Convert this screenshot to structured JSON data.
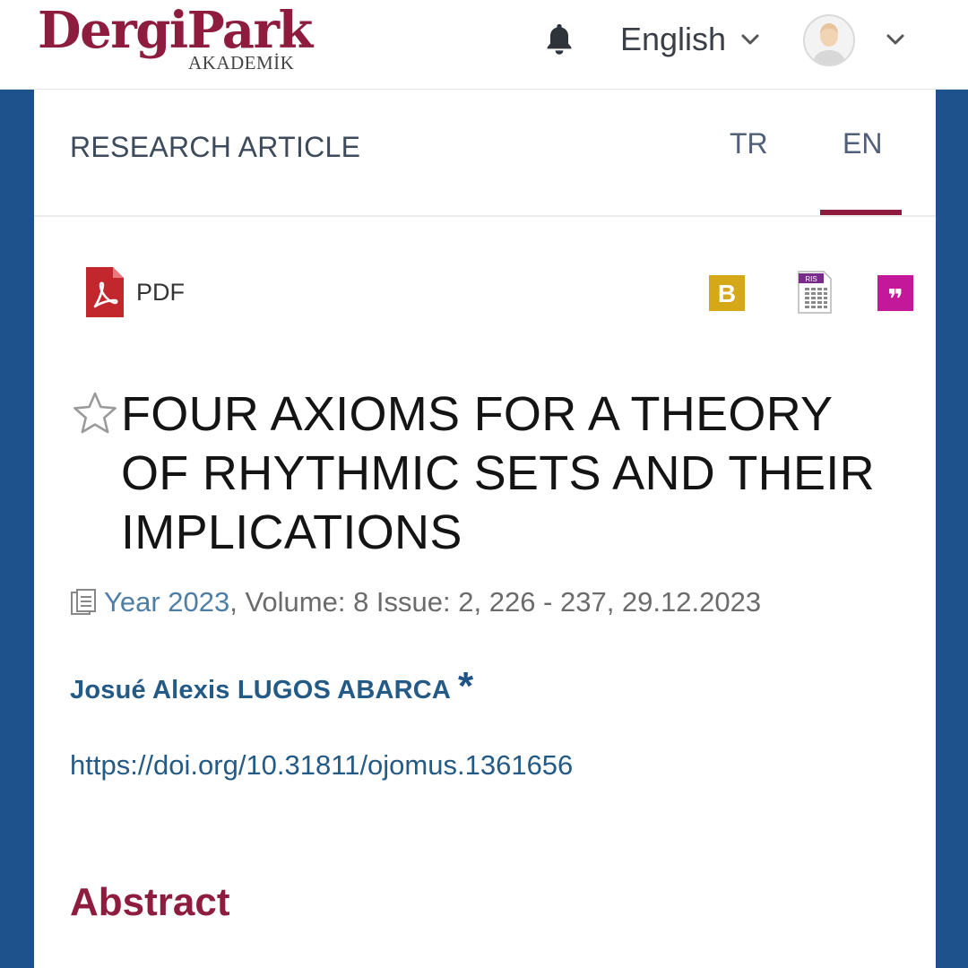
{
  "header": {
    "logo_main": "DergiPark",
    "logo_sub": "AKADEMİK",
    "language": "English"
  },
  "article": {
    "type": "RESEARCH ARTICLE",
    "tabs": [
      {
        "label": "TR",
        "active": false
      },
      {
        "label": "EN",
        "active": true
      }
    ],
    "pdf_label": "PDF",
    "title": "FOUR AXIOMS FOR A THEORY OF RHYTHMIC SETS AND THEIR IMPLICATIONS",
    "meta": {
      "year": "Year 2023",
      "rest": ", Volume: 8 Issue: 2, 226 - 237, 29.12.2023"
    },
    "author": "Josué Alexis LUGOS ABARCA",
    "author_marker": "*",
    "doi": "https://doi.org/10.31811/ojomus.1361656",
    "abstract_heading": "Abstract"
  },
  "tools": {
    "bibtex_letter": "B",
    "ris_label": "RIS",
    "cite_glyph": "❞"
  },
  "colors": {
    "brand": "#8d1c3e",
    "side_bars": "#1d528c",
    "link": "#235a86",
    "bibtex_bg": "#d4a816",
    "cite_bg": "#c4189a",
    "ris_band": "#7a2a8a"
  },
  "icons": [
    "bell-icon",
    "chevron-down-icon",
    "avatar",
    "pdf-icon",
    "bibtex-icon",
    "ris-icon",
    "cite-icon",
    "star-icon",
    "issue-icon"
  ]
}
